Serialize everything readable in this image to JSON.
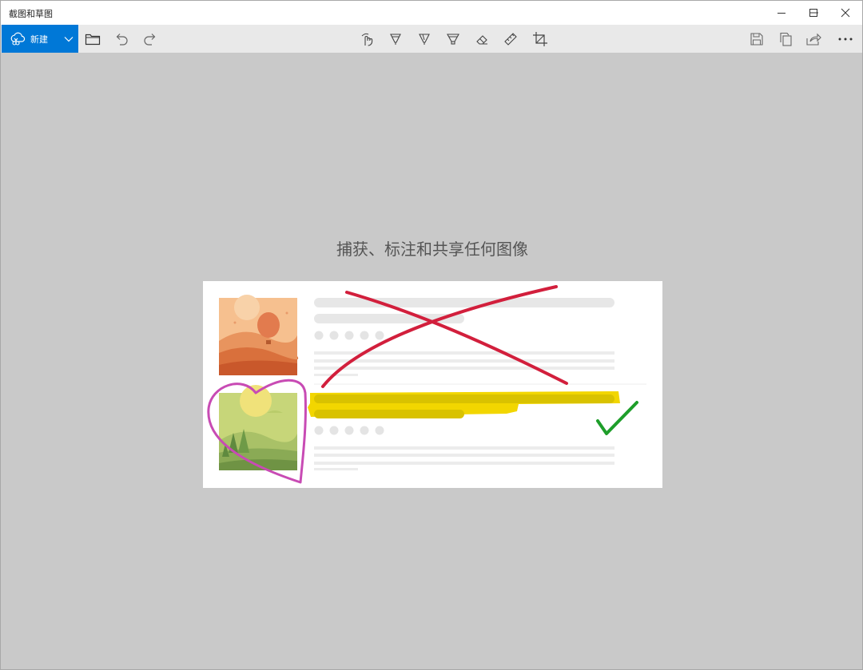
{
  "window": {
    "title": "截图和草图"
  },
  "toolbar": {
    "new_label": "新建",
    "left_icons": [
      "snip-cloud-icon",
      "chevron-down-icon",
      "folder-icon",
      "undo-icon",
      "redo-icon"
    ],
    "center_icons": [
      "touch-writing-icon",
      "ballpoint-pen-icon",
      "pencil-icon",
      "highlighter-icon",
      "eraser-icon",
      "ruler-icon",
      "crop-icon"
    ],
    "right_icons": [
      "save-icon",
      "copy-icon",
      "share-icon",
      "more-icon"
    ]
  },
  "main": {
    "headline": "捕获、标注和共享任何图像"
  },
  "colors": {
    "accent": "#0078d7",
    "canvas": "#c9c9c9",
    "toolbar": "#e9e9e9",
    "cross": "#d21f3c",
    "highlight": "#f2d600",
    "check": "#1e9e2a",
    "heart": "#c84bb4"
  }
}
